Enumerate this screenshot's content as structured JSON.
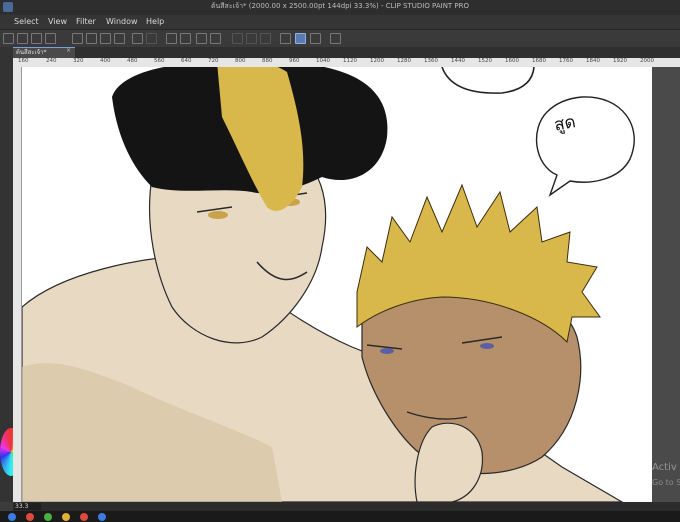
{
  "window": {
    "title": "ต้นสีสะเจ้า* (2000.00 x 2500.00pt 144dpi 33.3%) - CLIP STUDIO PAINT PRO"
  },
  "menu": {
    "items": [
      "Select",
      "View",
      "Filter",
      "Window",
      "Help"
    ]
  },
  "document_tab": {
    "label": "ต้นสีสะเจ้า*",
    "close": "×"
  },
  "ruler": {
    "labels": [
      "160",
      "240",
      "320",
      "400",
      "480",
      "560",
      "640",
      "720",
      "800",
      "880",
      "960",
      "1040",
      "1120",
      "1200",
      "1280",
      "1360",
      "1440",
      "1520",
      "1600",
      "1680",
      "1760",
      "1840",
      "1920",
      "2000"
    ]
  },
  "status": {
    "zoom": "33.3"
  },
  "canvas": {
    "speech_text": "สูด"
  },
  "overlay": {
    "line1": "Activ",
    "line2": "Go to S"
  },
  "icons": [
    "app-logo-icon",
    "hamburger-menu-icon",
    "new-file-icon",
    "open-folder-icon",
    "save-icon",
    "undo-icon",
    "redo-icon",
    "eraser-icon",
    "fill-icon",
    "pen-icon",
    "snap-icon"
  ],
  "colors": {
    "accent": "#5a7ab0",
    "hair_black": "#141414",
    "hair_blonde": "#d8b84a",
    "skin_light": "#e8d9c3",
    "skin_dark": "#b6906a"
  }
}
